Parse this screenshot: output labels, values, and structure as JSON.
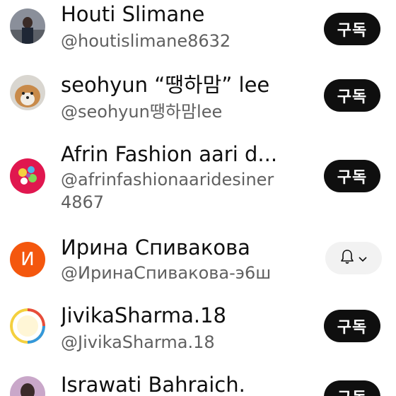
{
  "subscriptions": [
    {
      "name": "Houti Slimane",
      "handle": "@houtislimane8632",
      "button": "구독"
    },
    {
      "name": "seohyun “땡하맘” lee",
      "handle": "@seohyun땡하맘lee",
      "button": "구독"
    },
    {
      "name": "Afrin Fashion aari d...",
      "handle": "@afrinfashionaaridesiner",
      "handle_cont": "4867",
      "button": "구독"
    },
    {
      "name": "Ирина Спивакова",
      "handle": "@ИринаСпивакова-э6ш",
      "avatar_letter": "И",
      "button_icon": "bell-icon"
    },
    {
      "name": "JivikaSharma.18",
      "handle": "@JivikaSharma.18",
      "button": "구독"
    },
    {
      "name": "Israwati Bahraich.",
      "button": "구독"
    }
  ],
  "colors": {
    "letter_avatar": "#f4570e",
    "subscribe_bg": "#0f0f0f",
    "subscribed_bg": "#f2f2f2"
  }
}
